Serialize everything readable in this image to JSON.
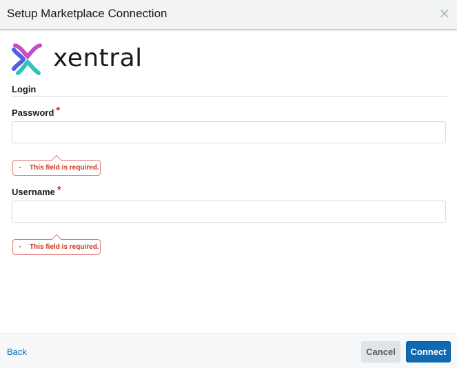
{
  "dialog": {
    "title": "Setup Marketplace Connection",
    "close_icon": "close-icon",
    "close_glyph": "×"
  },
  "brand": {
    "name": "xentral",
    "logo_icon": "xentral-logo-icon",
    "colors": {
      "pink": "#c34fc3",
      "blue": "#4f5fe0",
      "teal": "#2ec4b6"
    }
  },
  "form": {
    "section_title": "Login",
    "fields": [
      {
        "label": "Password",
        "required_marker": "*",
        "value": "",
        "placeholder": "",
        "error": "This field is required."
      },
      {
        "label": "Username",
        "required_marker": "*",
        "value": "",
        "placeholder": "",
        "error": "This field is required."
      }
    ]
  },
  "footer": {
    "back_label": "Back",
    "cancel_label": "Cancel",
    "connect_label": "Connect"
  },
  "colors": {
    "accent": "#0f6ab4",
    "error": "#d13212",
    "link": "#0073bb"
  }
}
